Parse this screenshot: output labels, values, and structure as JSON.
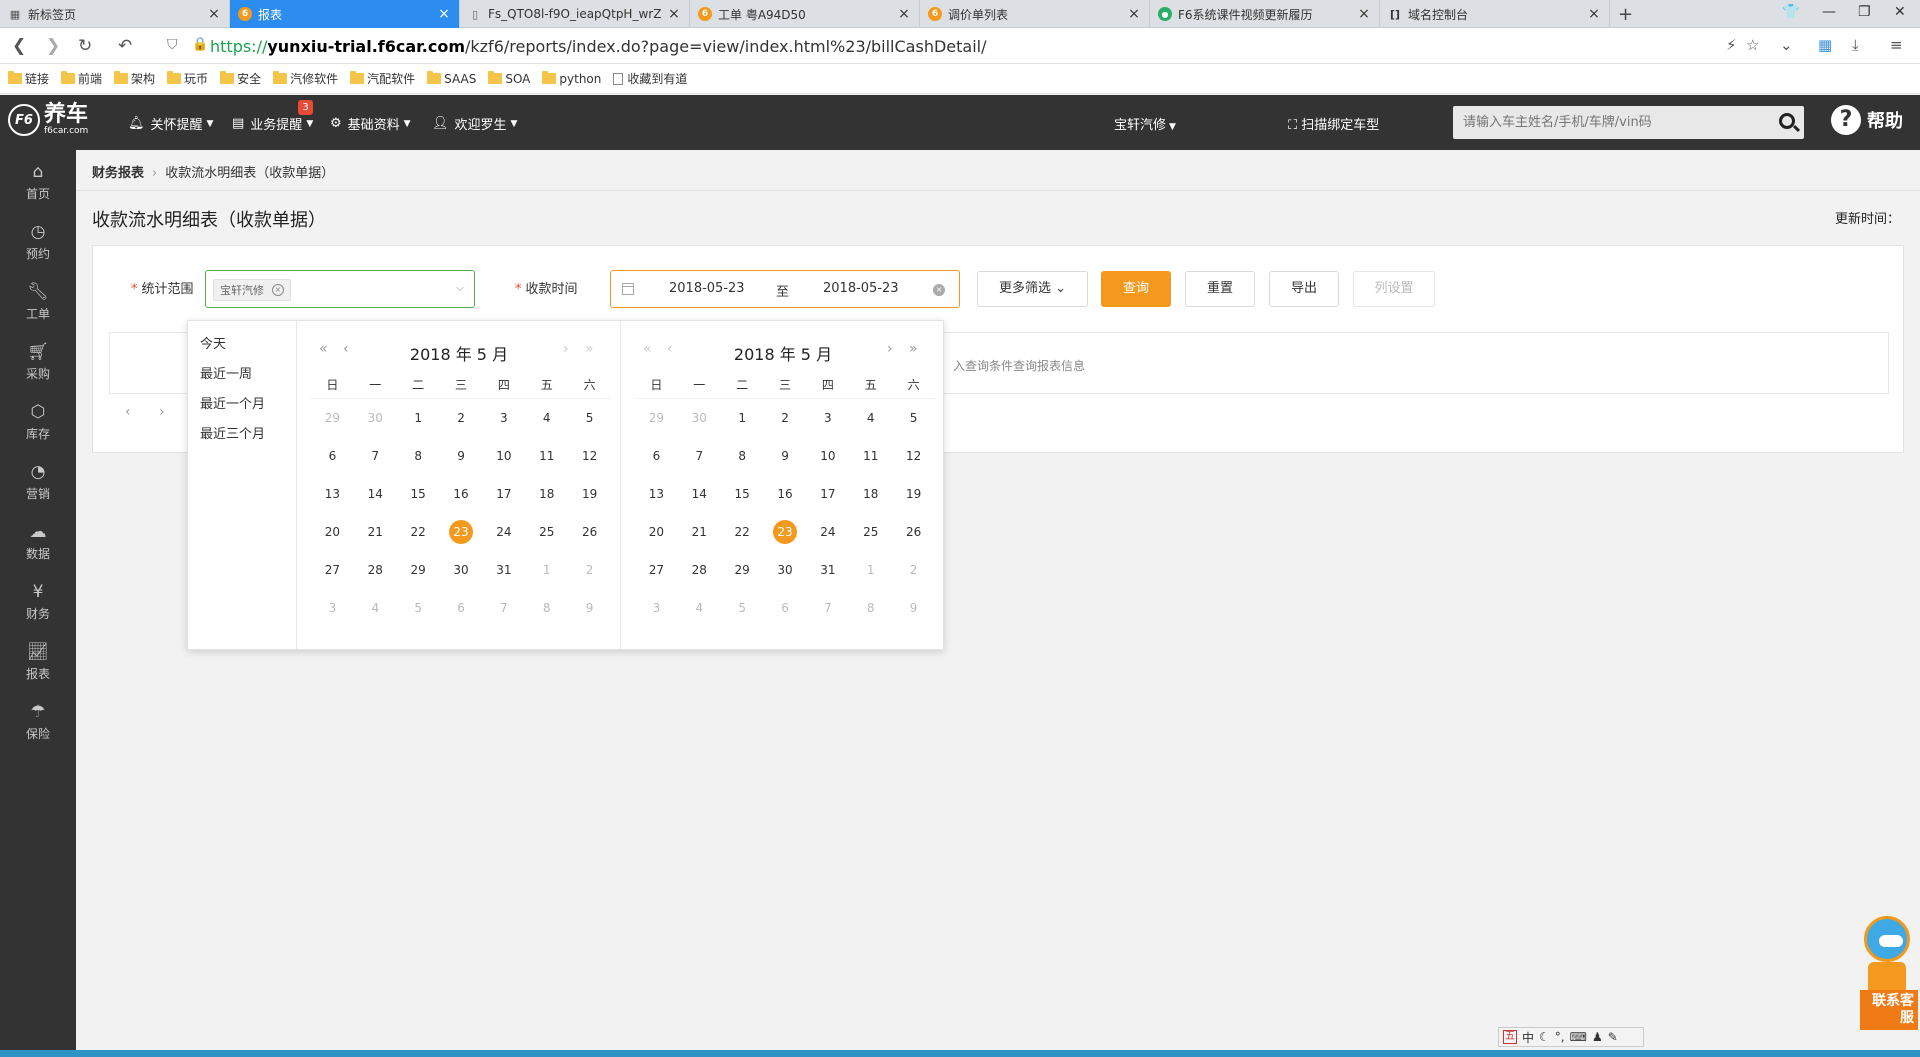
{
  "browser": {
    "tabs": [
      {
        "label": "新标签页",
        "icon": "grid-icon"
      },
      {
        "label": "报表",
        "icon": "f6-icon",
        "active": true
      },
      {
        "label": "Fs_QTO8l-f9O_ieapQtpH_wrZ",
        "icon": "doc-icon"
      },
      {
        "label": "工单 粤A94D50",
        "icon": "f6-icon"
      },
      {
        "label": "调价单列表",
        "icon": "f6-icon"
      },
      {
        "label": "F6系统课件视频更新履历",
        "icon": "wechat-icon"
      },
      {
        "label": "域名控制台",
        "icon": "bracket-icon"
      }
    ],
    "url_scheme": "https://",
    "url_host": "yunxiu-trial.f6car.com",
    "url_path": "/kzf6/reports/index.do?page=view/index.html%23/billCashDetail/",
    "bookmarks": [
      {
        "label": "链接",
        "type": "folder"
      },
      {
        "label": "前端",
        "type": "folder"
      },
      {
        "label": "架构",
        "type": "folder"
      },
      {
        "label": "玩币",
        "type": "folder"
      },
      {
        "label": "安全",
        "type": "folder"
      },
      {
        "label": "汽修软件",
        "type": "folder"
      },
      {
        "label": "汽配软件",
        "type": "folder"
      },
      {
        "label": "SAAS",
        "type": "folder"
      },
      {
        "label": "SOA",
        "type": "folder"
      },
      {
        "label": "python",
        "type": "folder"
      },
      {
        "label": "收藏到有道",
        "type": "page"
      }
    ]
  },
  "header": {
    "logo_text": "养车",
    "logo_sub": "f6car.com",
    "logo_mark": "F6",
    "menus": [
      {
        "label": "关怀提醒",
        "icon": "bell-icon"
      },
      {
        "label": "业务提醒",
        "icon": "clipboard-icon",
        "badge": "3"
      },
      {
        "label": "基础资料",
        "icon": "gear-icon"
      },
      {
        "label": "欢迎罗生",
        "icon": "user-icon"
      }
    ],
    "store": "宝轩汽修",
    "scan_label": "扫描绑定车型",
    "search_placeholder": "请输入车主姓名/手机/车牌/vin码",
    "help_label": "帮助"
  },
  "sidebar": [
    {
      "label": "首页",
      "icon": "home-icon"
    },
    {
      "label": "预约",
      "icon": "clock-icon"
    },
    {
      "label": "工单",
      "icon": "wrench-icon"
    },
    {
      "label": "采购",
      "icon": "cart-icon"
    },
    {
      "label": "库存",
      "icon": "box-icon"
    },
    {
      "label": "营销",
      "icon": "pie-icon"
    },
    {
      "label": "数据",
      "icon": "cloud-icon"
    },
    {
      "label": "财务",
      "icon": "yen-icon"
    },
    {
      "label": "报表",
      "icon": "chart-icon"
    },
    {
      "label": "保险",
      "icon": "umbrella-icon"
    }
  ],
  "page": {
    "breadcrumb_root": "财务报表",
    "breadcrumb_current": "收款流水明细表（收款单据）",
    "title": "收款流水明细表（收款单据）",
    "update_time_label": "更新时间："
  },
  "filters": {
    "range_label": "统计范围",
    "range_tag": "宝轩汽修",
    "date_label": "收款时间",
    "date_start": "2018-05-23",
    "date_sep": "至",
    "date_end": "2018-05-23",
    "more_filter": "更多筛选",
    "query": "查询",
    "reset": "重置",
    "export": "导出",
    "columns": "列设置",
    "empty_message": "入查询条件查询报表信息"
  },
  "picker": {
    "shortcuts": [
      "今天",
      "最近一周",
      "最近一个月",
      "最近三个月"
    ],
    "left_title": "2018 年 5 月",
    "right_title": "2018 年 5 月",
    "weekdays": [
      "日",
      "一",
      "二",
      "三",
      "四",
      "五",
      "六"
    ],
    "weeks": [
      [
        [
          "29",
          1
        ],
        [
          "30",
          1
        ],
        [
          "1",
          0
        ],
        [
          "2",
          0
        ],
        [
          "3",
          0
        ],
        [
          "4",
          0
        ],
        [
          "5",
          0
        ]
      ],
      [
        [
          "6",
          0
        ],
        [
          "7",
          0
        ],
        [
          "8",
          0
        ],
        [
          "9",
          0
        ],
        [
          "10",
          0
        ],
        [
          "11",
          0
        ],
        [
          "12",
          0
        ]
      ],
      [
        [
          "13",
          0
        ],
        [
          "14",
          0
        ],
        [
          "15",
          0
        ],
        [
          "16",
          0
        ],
        [
          "17",
          0
        ],
        [
          "18",
          0
        ],
        [
          "19",
          0
        ]
      ],
      [
        [
          "20",
          0
        ],
        [
          "21",
          0
        ],
        [
          "22",
          0
        ],
        [
          "23",
          2
        ],
        [
          "24",
          0
        ],
        [
          "25",
          0
        ],
        [
          "26",
          0
        ]
      ],
      [
        [
          "27",
          0
        ],
        [
          "28",
          0
        ],
        [
          "29",
          0
        ],
        [
          "30",
          0
        ],
        [
          "31",
          0
        ],
        [
          "1",
          1
        ],
        [
          "2",
          1
        ]
      ],
      [
        [
          "3",
          1
        ],
        [
          "4",
          1
        ],
        [
          "5",
          1
        ],
        [
          "6",
          1
        ],
        [
          "7",
          1
        ],
        [
          "8",
          1
        ],
        [
          "9",
          1
        ]
      ]
    ]
  },
  "mascot_label": "联系客服",
  "ime": "中",
  "colors": {
    "accent": "#f39a1e",
    "header_bg": "#333333",
    "active_tab": "#2d8cf0",
    "valid": "#55b04d"
  }
}
